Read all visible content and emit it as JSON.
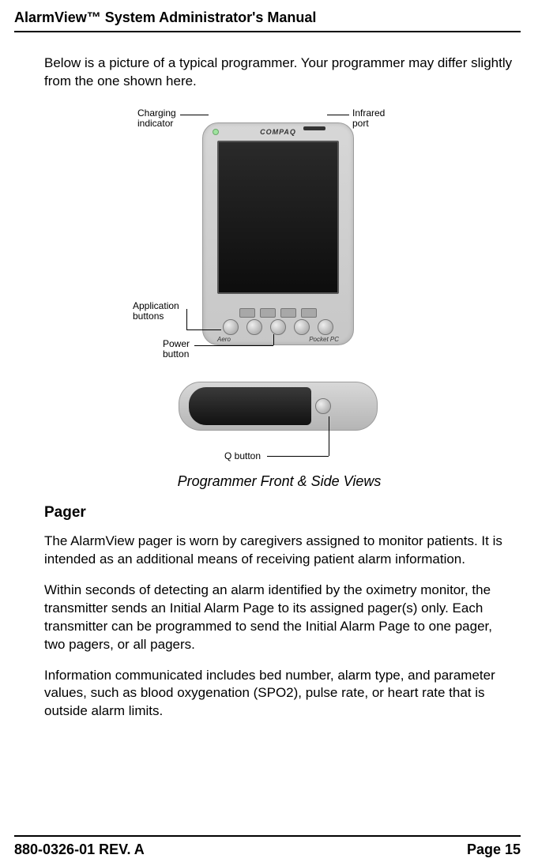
{
  "header": {
    "title": "AlarmView™ System Administrator's Manual"
  },
  "intro_text": "Below is a picture of a typical programmer. Your programmer may differ slightly from the one shown here.",
  "figure": {
    "callouts": {
      "charging": "Charging\nindicator",
      "infrared": "Infrared\nport",
      "app_buttons": "Application\nbuttons",
      "power": "Power\nbutton",
      "q_button": "Q button"
    },
    "brand_top": "COMPAQ",
    "brand_left": "Aero",
    "brand_right": "Pocket PC",
    "caption": "Programmer Front & Side Views"
  },
  "section": {
    "heading": "Pager",
    "p1": "The AlarmView pager is worn by caregivers assigned to monitor patients. It is intended as an additional means of receiving patient alarm information.",
    "p2": "Within seconds of detecting an alarm identified by the oximetry monitor, the transmitter sends an Initial Alarm Page to its assigned pager(s) only. Each transmitter can be programmed to send the Initial Alarm Page to one pager, two pagers, or all pagers.",
    "p3": "Information communicated includes bed number, alarm type, and parameter values, such as blood oxygenation (SPO2), pulse rate, or heart rate that is outside alarm limits."
  },
  "footer": {
    "left": "880-0326-01 REV. A",
    "right": "Page 15"
  }
}
